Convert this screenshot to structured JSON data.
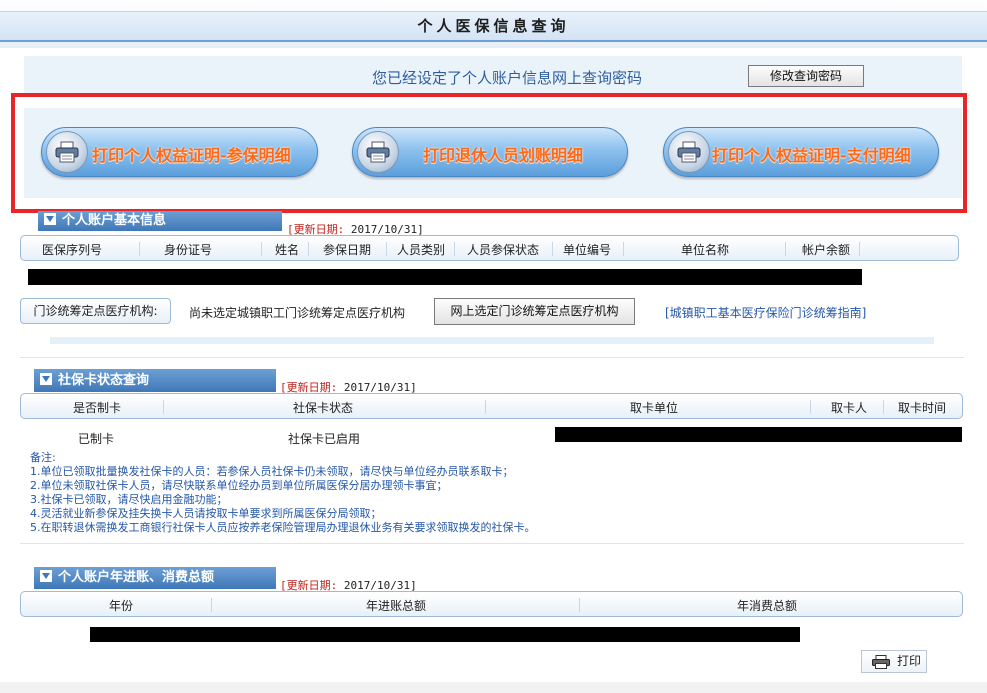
{
  "page_title": "个人医保信息查询",
  "password_bar": {
    "message": "您已经设定了个人账户信息网上查询密码",
    "button": "修改查询密码"
  },
  "print_buttons": [
    {
      "label": "打印个人权益证明-参保明细",
      "icon": "printer-icon"
    },
    {
      "label": "打印退休人员划账明细",
      "icon": "printer-icon"
    },
    {
      "label": "打印个人权益证明-支付明细",
      "icon": "printer-icon"
    }
  ],
  "basic_info": {
    "section_title": "个人账户基本信息",
    "update_key": "[更新日期:",
    "update_value": " 2017/10/31]",
    "columns": [
      "医保序列号",
      "身份证号",
      "姓名",
      "参保日期",
      "人员类别",
      "人员参保状态",
      "单位编号",
      "单位名称",
      "帐户余额"
    ]
  },
  "clinic": {
    "label": "门诊统筹定点医疗机构:",
    "status": "尚未选定城镇职工门诊统筹定点医疗机构",
    "select_button": "网上选定门诊统筹定点医疗机构",
    "guide_link": "[城镇职工基本医疗保险门诊统筹指南]"
  },
  "card_status": {
    "section_title": "社保卡状态查询",
    "update_key": "[更新日期:",
    "update_value": " 2017/10/31]",
    "columns": [
      "是否制卡",
      "社保卡状态",
      "取卡单位",
      "取卡人",
      "取卡时间"
    ],
    "row": [
      "已制卡",
      "社保卡已启用"
    ]
  },
  "notes": {
    "title": "备注:",
    "items": [
      "1.单位已领取批量换发社保卡的人员：若参保人员社保卡仍未领取，请尽快与单位经办员联系取卡；",
      "2.单位未领取社保卡人员，请尽快联系单位经办员到单位所属医保分居办理领卡事宜；",
      "3.社保卡已领取，请尽快启用金融功能；",
      "4.灵活就业新参保及挂失换卡人员请按取卡单要求到所属医保分局领取；",
      "5.在职转退休需换发工商银行社保卡人员应按养老保险管理局办理退休业务有关要求领取换发的社保卡。"
    ]
  },
  "annual": {
    "section_title": "个人账户年进账、消费总额",
    "update_key": "[更新日期:",
    "update_value": " 2017/10/31]",
    "columns": [
      "年份",
      "年进账总额",
      "年消费总额"
    ]
  },
  "print_label": "打印"
}
